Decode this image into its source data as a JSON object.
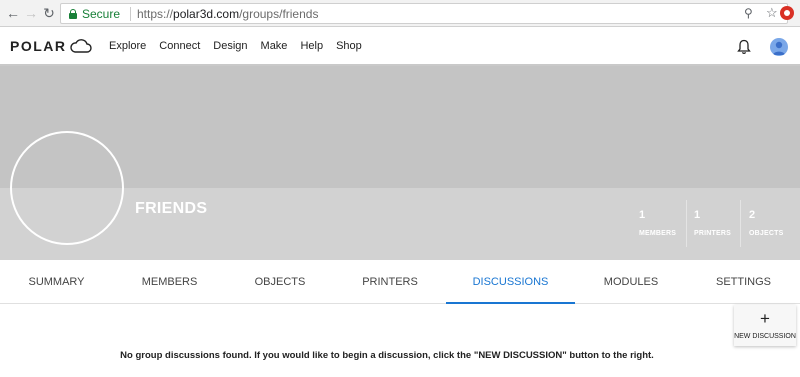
{
  "browser": {
    "secure_label": "Secure",
    "url_scheme": "https://",
    "url_host": "polar3d.com",
    "url_path": "/groups/friends"
  },
  "header": {
    "logo_text": "POLAR",
    "nav": [
      "Explore",
      "Connect",
      "Design",
      "Make",
      "Help",
      "Shop"
    ]
  },
  "group": {
    "name": "FRIENDS",
    "stats": [
      {
        "value": "1",
        "label": "MEMBERS"
      },
      {
        "value": "1",
        "label": "PRINTERS"
      },
      {
        "value": "2",
        "label": "OBJECTS"
      }
    ]
  },
  "tabs": [
    {
      "label": "SUMMARY",
      "active": false
    },
    {
      "label": "MEMBERS",
      "active": false
    },
    {
      "label": "OBJECTS",
      "active": false
    },
    {
      "label": "PRINTERS",
      "active": false
    },
    {
      "label": "DISCUSSIONS",
      "active": true
    },
    {
      "label": "MODULES",
      "active": false
    },
    {
      "label": "SETTINGS",
      "active": false
    }
  ],
  "content": {
    "new_discussion_icon": "+",
    "new_discussion_label": "NEW DISCUSSION",
    "empty_message": "No group discussions found. If you would like to begin a discussion, click the \"NEW DISCUSSION\" button to the right."
  },
  "colors": {
    "accent": "#1976d2",
    "secure_green": "#188038",
    "banner_top": "#c4c4c4",
    "banner_bottom": "#d2d2d2"
  }
}
